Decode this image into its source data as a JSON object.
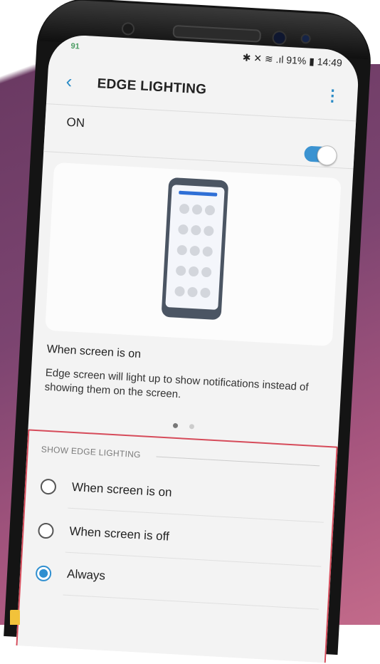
{
  "status_bar": {
    "left_text": "91",
    "right_text": "✱ ✕ ≋ .ıl 91% ▮ 14:49"
  },
  "app_bar": {
    "back_icon": "back-chevron-icon",
    "title": "EDGE LIGHTING",
    "more_icon": "more-vert-icon"
  },
  "master_switch": {
    "label": "ON",
    "state": "on",
    "accent": "#3b93d1"
  },
  "preview": {
    "caption_title": "When screen is on",
    "caption_desc": "Edge screen will light up to show notifications instead of showing them on the screen.",
    "page_count": 2,
    "current_page": 1
  },
  "options": {
    "section_label": "SHOW EDGE LIGHTING",
    "items": [
      {
        "label": "When screen is on",
        "selected": false
      },
      {
        "label": "When screen is off",
        "selected": false
      },
      {
        "label": "Always",
        "selected": true
      }
    ],
    "highlight_color": "#d64b5a"
  }
}
